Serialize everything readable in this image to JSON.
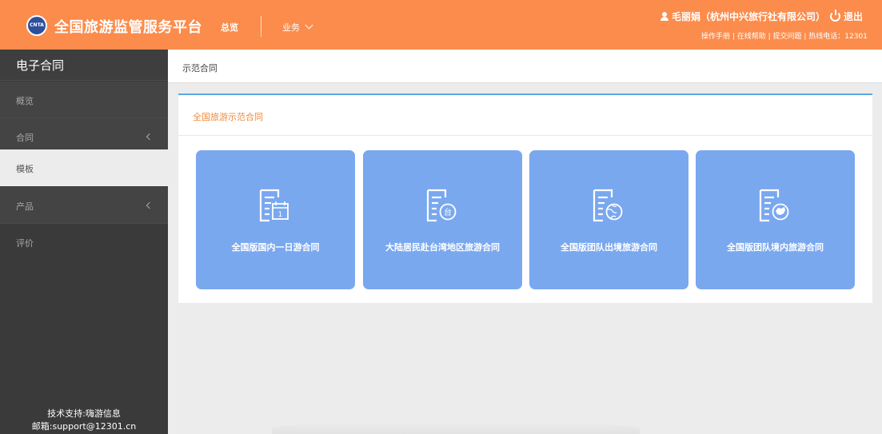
{
  "header": {
    "logo_text": "CNTA",
    "app_title": "全国旅游监管服务平台",
    "nav_overview": "总览",
    "nav_business": "业务",
    "user_name": "毛丽娟（杭州中兴旅行社有限公司）",
    "logout_label": "退出",
    "help_links": "操作手册 | 在线帮助 | 提交问题 | 热线电话：12301"
  },
  "sidebar": {
    "title": "电子合同",
    "items": [
      {
        "label": "概览",
        "has_submenu": false,
        "active": false
      },
      {
        "label": "合同",
        "has_submenu": true,
        "active": false
      },
      {
        "label": "模板",
        "has_submenu": false,
        "active": true
      },
      {
        "label": "产品",
        "has_submenu": true,
        "active": false
      },
      {
        "label": "评价",
        "has_submenu": false,
        "active": false
      }
    ],
    "support_line1": "技术支持:嗨游信息",
    "support_line2": "邮箱:support@12301.cn"
  },
  "main": {
    "breadcrumb": "示范合同",
    "panel_title": "全国旅游示范合同",
    "cards": [
      {
        "label": "全国版国内一日游合同",
        "icon": "contract-calendar-icon"
      },
      {
        "label": "大陆居民赴台湾地区旅游合同",
        "icon": "contract-taiwan-icon"
      },
      {
        "label": "全国版团队出境旅游合同",
        "icon": "contract-globe-icon"
      },
      {
        "label": "全国版团队境内旅游合同",
        "icon": "contract-china-map-icon"
      }
    ]
  },
  "colors": {
    "header_bg": "#fb8c4c",
    "sidebar_bg": "#3a3a3a",
    "card_bg": "#7aa8ef",
    "panel_title": "#f08a3a",
    "panel_border": "#5aa7e6"
  }
}
